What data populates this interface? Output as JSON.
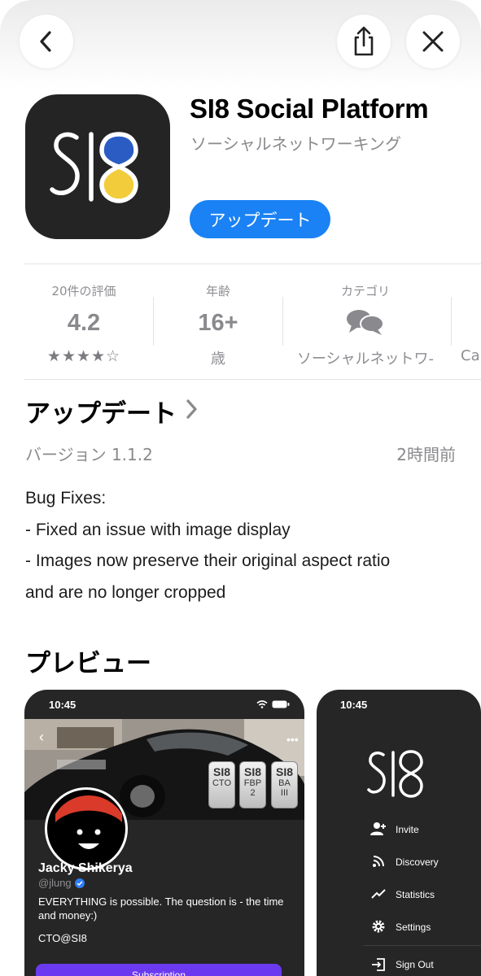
{
  "app": {
    "title": "SI8 Social Platform",
    "subtitle": "ソーシャルネットワーキング",
    "update_button": "アップデート",
    "icon_text": "SI8"
  },
  "stats": [
    {
      "label": "20件の評価",
      "value": "4.2",
      "sub": "★★★★☆"
    },
    {
      "label": "年齢",
      "value": "16+",
      "sub": "歳"
    },
    {
      "label": "カテゴリ",
      "value": "speech-bubbles-icon",
      "sub": "ソーシャルネットワ-"
    },
    {
      "label": "",
      "value": "",
      "sub": "Ca"
    }
  ],
  "update_section": {
    "title": "アップデート",
    "version": "バージョン 1.1.2",
    "time": "2時間前",
    "notes": [
      "Bug Fixes:",
      "- Fixed an issue with image display",
      "- Images now preserve their original aspect ratio",
      "and are no longer cropped"
    ]
  },
  "preview": {
    "title": "プレビュー",
    "screen1": {
      "status_time": "10:45",
      "badges": [
        {
          "logo": "SI8",
          "text": "CTO"
        },
        {
          "logo": "SI8",
          "text": "FBP\n2"
        },
        {
          "logo": "SI8",
          "text": "BA\nIII"
        }
      ],
      "name": "Jacky Shikerya",
      "handle": "@jlung",
      "bio": "EVERYTHING is possible. The question is - the time and money:)",
      "email": "CTO@SI8",
      "subscription_button": "Subscription"
    },
    "screen2": {
      "status_time": "10:45",
      "logo": "SI8",
      "menu": [
        "Invite",
        "Discovery",
        "Statistics",
        "Settings",
        "Sign Out"
      ]
    }
  },
  "colors": {
    "accent": "#1a82f4",
    "icon_bg": "#242424",
    "logo_blue": "#2a5cc4",
    "logo_yellow": "#f2cc3a"
  }
}
